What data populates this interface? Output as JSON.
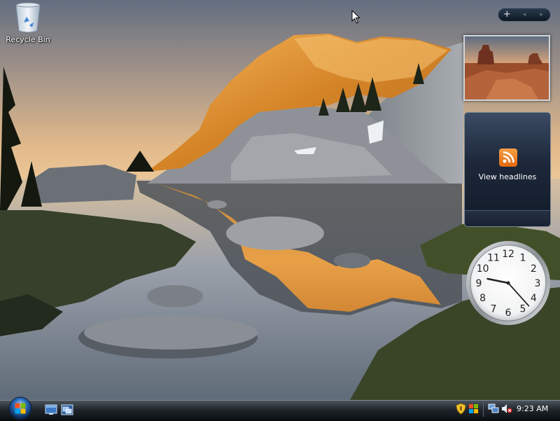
{
  "desktop": {
    "recycle_bin_label": "Recycle Bin"
  },
  "sidebar": {
    "controls": {
      "add_symbol": "+",
      "prev_symbol": "◂",
      "next_symbol": "▸"
    },
    "feed_gadget": {
      "label": "View headlines"
    },
    "clock_gadget": {
      "time_shown": "9:23",
      "numerals": [
        "12",
        "1",
        "2",
        "3",
        "4",
        "5",
        "6",
        "7",
        "8",
        "9",
        "10",
        "11"
      ]
    }
  },
  "taskbar": {
    "start_button": "start-orb",
    "quick_launch": [
      "show-desktop-icon",
      "switch-windows-icon"
    ],
    "tray_icons": [
      "security-shield-icon",
      "network-icon",
      "volume-muted-icon"
    ],
    "clock": "9:23 AM"
  },
  "colors": {
    "taskbar_top": "#4b535c",
    "taskbar_bottom": "#0a0d10",
    "rss_orange": "#f08a2c",
    "orb_blue": "#2b6fc0"
  }
}
